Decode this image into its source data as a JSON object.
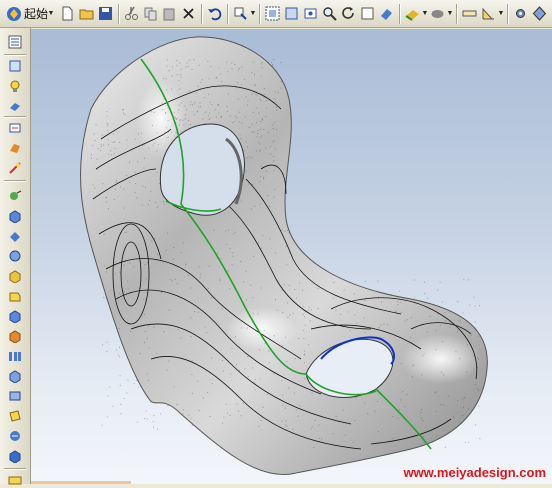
{
  "toolbar": {
    "start_label": "起始",
    "buttons": [
      "start-menu",
      "new-file",
      "open-file",
      "save-file",
      "cut",
      "copy",
      "paste",
      "delete",
      "undo",
      "select-filter",
      "fit-view",
      "zoom-window",
      "pan",
      "zoom",
      "rotate",
      "shade",
      "render-style",
      "view-orientation",
      "display-options",
      "measure",
      "analysis",
      "settings"
    ]
  },
  "sidebar": {
    "buttons": [
      "part-navigator",
      "assembly-navigator",
      "reuse-library",
      "roles",
      "history",
      "web-browser",
      "system-materials",
      "sketch",
      "extrude",
      "revolve",
      "hole",
      "boss",
      "pocket",
      "edge-blend",
      "chamfer",
      "shell",
      "pattern",
      "mirror",
      "trim-body",
      "sew",
      "through-curves",
      "bounded-plane",
      "studio-surface"
    ]
  },
  "colors": {
    "viewport_top": "#A9BCD6",
    "viewport_bottom": "#F3F6FA",
    "green_curve": "#1FA22A",
    "blue_curve": "#1030D0",
    "watermark": "#E0151B"
  },
  "watermark": "www.meiyadesign.com"
}
